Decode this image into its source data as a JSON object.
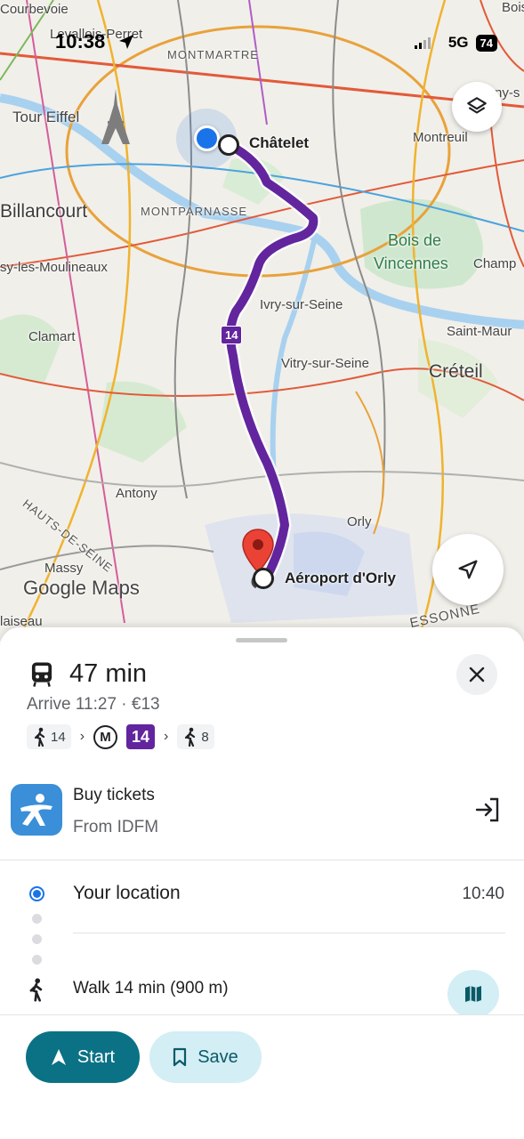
{
  "status_bar": {
    "time": "10:38",
    "network": "5G",
    "battery": "74"
  },
  "map": {
    "labels": {
      "courbevoie": "Courbevoie",
      "levallois": "Levallois-Perret",
      "montmartre": "MONTMARTRE",
      "tour_eiffel": "Tour Eiffel",
      "montreuil": "Montreuil",
      "billancourt": "Billancourt",
      "montparnasse": "MONTPARNASSE",
      "bois_de": "Bois de",
      "vincennes": "Vincennes",
      "champ": "Champ",
      "moulineaux": "sy-les-Moulineaux",
      "ivry": "Ivry-sur-Seine",
      "clamart": "Clamart",
      "saint_maur": "Saint-Maur",
      "vitry": "Vitry-sur-Seine",
      "creteil": "Créteil",
      "hauts_de_seine": "HAUTS-DE-SEINE",
      "antony": "Antony",
      "orly": "Orly",
      "massy": "Massy",
      "laiseau": "laiseau",
      "essonne": "ESSONNE",
      "bois_corner": "Bois",
      "ny_corner": "ny-s"
    },
    "origin_label": "Châtelet",
    "destination_label": "Aéroport d'Orly",
    "route_line": "14",
    "route_color": "#62259d",
    "attribution": "Google Maps"
  },
  "trip": {
    "duration": "47 min",
    "arrive": "Arrive 11:27 · €13",
    "steps": {
      "walk_start": "14",
      "metro_symbol": "M",
      "line": "14",
      "walk_end": "8"
    }
  },
  "tickets": {
    "title": "Buy tickets",
    "subtitle": "From IDFM"
  },
  "itinerary": {
    "start_label": "Your location",
    "start_time": "10:40",
    "walk_label": "Walk 14 min (900 m)"
  },
  "actions": {
    "start": "Start",
    "save": "Save"
  },
  "colors": {
    "accent": "#0b7285",
    "accent_light": "#d3eef4",
    "blue_dot": "#1a73e8",
    "route": "#62259d"
  }
}
